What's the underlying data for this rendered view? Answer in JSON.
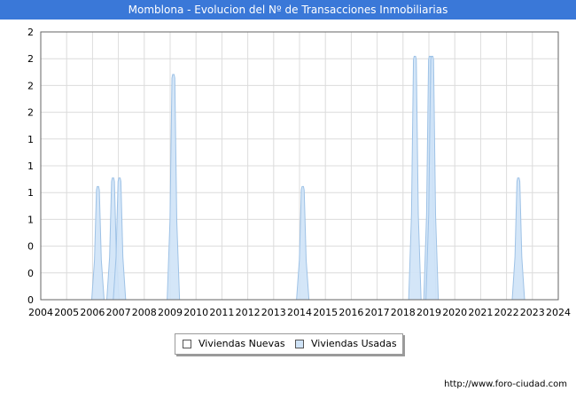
{
  "page": {
    "title": "Momblona - Evolucion del Nº de Transacciones Inmobiliarias",
    "url": "http://www.foro-ciudad.com",
    "watermark": "FORO-CIUDAD.COM"
  },
  "legend": [
    {
      "label": "Viviendas Nuevas",
      "color": "#ffffff"
    },
    {
      "label": "Viviendas Usadas",
      "color": "#cfe3f7"
    }
  ],
  "chart_data": {
    "type": "area",
    "title": "Momblona - Evolucion del Nº de Transacciones Inmobiliarias",
    "xlabel": "",
    "ylabel": "",
    "x_ticks": [
      "2004",
      "2005",
      "2006",
      "2007",
      "2008",
      "2009",
      "2010",
      "2011",
      "2012",
      "2013",
      "2014",
      "2015",
      "2016",
      "2017",
      "2018",
      "2019",
      "2020",
      "2021",
      "2022",
      "2023",
      "2024"
    ],
    "y_ticks": [
      "0",
      "0",
      "0",
      "1",
      "1",
      "1",
      "1",
      "2",
      "2",
      "2",
      "2"
    ],
    "ylim": [
      0,
      2.2
    ],
    "xlim": [
      2004,
      2024
    ],
    "grid": true,
    "legend_position": "bottom",
    "series": [
      {
        "name": "Viviendas Nuevas",
        "color": "#ffffff",
        "points": []
      },
      {
        "name": "Viviendas Usadas",
        "color": "#cfe3f7",
        "points": [
          {
            "date": "2006-03",
            "value": 0.93
          },
          {
            "date": "2006-10",
            "value": 1.0
          },
          {
            "date": "2007-01",
            "value": 1.0
          },
          {
            "date": "2009-02",
            "value": 1.85
          },
          {
            "date": "2014-02",
            "value": 0.93
          },
          {
            "date": "2018-06",
            "value": 2.0
          },
          {
            "date": "2019-01",
            "value": 2.0
          },
          {
            "date": "2019-02",
            "value": 2.0
          },
          {
            "date": "2022-06",
            "value": 1.0
          }
        ]
      }
    ]
  }
}
